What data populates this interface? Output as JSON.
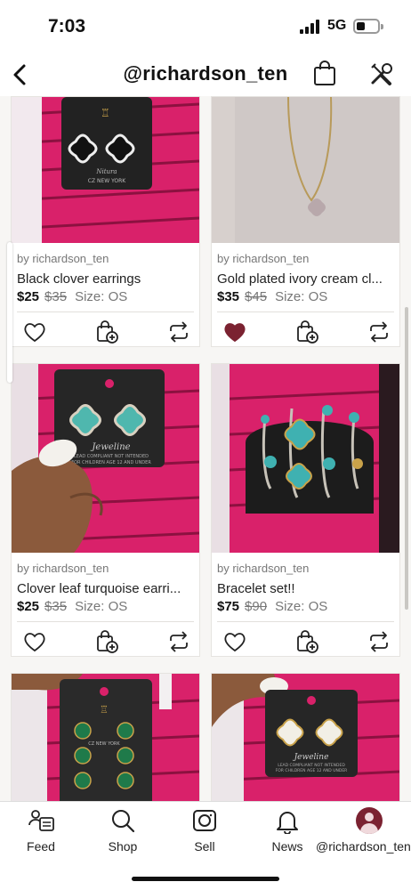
{
  "status_bar": {
    "time": "7:03",
    "network": "5G"
  },
  "header": {
    "title": "@richardson_ten"
  },
  "listings": [
    {
      "byline": "by richardson_ten",
      "title": "Black clover earrings",
      "price": "$25",
      "original_price": "$35",
      "size": "Size: OS",
      "liked": false
    },
    {
      "byline": "by richardson_ten",
      "title": "Gold plated ivory cream cl...",
      "price": "$35",
      "original_price": "$45",
      "size": "Size: OS",
      "liked": true
    },
    {
      "byline": "by richardson_ten",
      "title": "Clover leaf turquoise earri...",
      "price": "$25",
      "original_price": "$35",
      "size": "Size: OS",
      "liked": false
    },
    {
      "byline": "by richardson_ten",
      "title": "Bracelet set!!",
      "price": "$75",
      "original_price": "$90",
      "size": "Size: OS",
      "liked": false
    }
  ],
  "product_images": [
    {
      "icon": "black-clover-earrings-image",
      "card_text": [
        "Nitura",
        "CZ NEW YORK"
      ]
    },
    {
      "icon": "gold-necklace-image"
    },
    {
      "icon": "turquoise-earrings-image",
      "card_text": [
        "Jeweline",
        "LEAD COMPLIANT NOT INTENDED",
        "FOR CHILDREN AGE 12 AND UNDER"
      ]
    },
    {
      "icon": "bracelet-set-image"
    },
    {
      "icon": "green-clover-earrings-image",
      "card_text": [
        "CZ NEW YORK"
      ]
    },
    {
      "icon": "pearl-clover-earrings-image",
      "card_text": [
        "Jeweline",
        "LEAD COMPLIANT NOT INTENDED",
        "FOR CHILDREN AGE 12 AND UNDER"
      ]
    }
  ],
  "tabs": [
    {
      "label": "Feed",
      "icon": "feed-icon"
    },
    {
      "label": "Shop",
      "icon": "search-icon"
    },
    {
      "label": "Sell",
      "icon": "camera-icon"
    },
    {
      "label": "News",
      "icon": "bell-icon"
    },
    {
      "label": "@richardson_ten",
      "icon": "avatar"
    }
  ],
  "colors": {
    "like_active": "#7b2231",
    "wall_pink": "#d9216a",
    "ink": "#222222"
  }
}
